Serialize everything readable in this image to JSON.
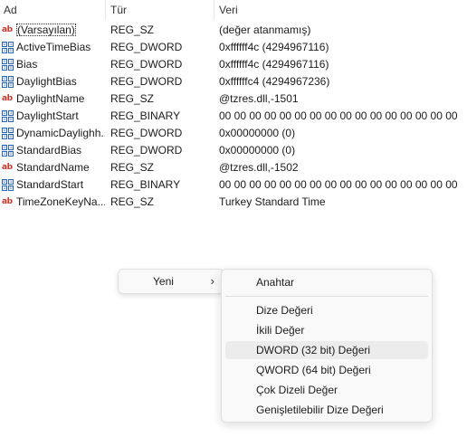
{
  "columns": {
    "name": "Ad",
    "type": "Tür",
    "data": "Veri"
  },
  "rows": [
    {
      "icon": "string-value-icon",
      "name": "(Varsayılan)",
      "type": "REG_SZ",
      "data": "(değer atanmamış)",
      "selected": true
    },
    {
      "icon": "binary-value-icon",
      "name": "ActiveTimeBias",
      "type": "REG_DWORD",
      "data": "0xffffff4c (4294967116)"
    },
    {
      "icon": "binary-value-icon",
      "name": "Bias",
      "type": "REG_DWORD",
      "data": "0xffffff4c (4294967116)"
    },
    {
      "icon": "binary-value-icon",
      "name": "DaylightBias",
      "type": "REG_DWORD",
      "data": "0xffffffc4 (4294967236)"
    },
    {
      "icon": "string-value-icon",
      "name": "DaylightName",
      "type": "REG_SZ",
      "data": "@tzres.dll,-1501"
    },
    {
      "icon": "binary-value-icon",
      "name": "DaylightStart",
      "type": "REG_BINARY",
      "data": "00 00 00 00 00 00 00 00 00 00 00 00 00 00 00 00"
    },
    {
      "icon": "binary-value-icon",
      "name": "DynamicDaylightTimeDisabled",
      "type": "REG_DWORD",
      "data": "0x00000000 (0)"
    },
    {
      "icon": "binary-value-icon",
      "name": "StandardBias",
      "type": "REG_DWORD",
      "data": "0x00000000 (0)"
    },
    {
      "icon": "string-value-icon",
      "name": "StandardName",
      "type": "REG_SZ",
      "data": "@tzres.dll,-1502"
    },
    {
      "icon": "binary-value-icon",
      "name": "StandardStart",
      "type": "REG_BINARY",
      "data": "00 00 00 00 00 00 00 00 00 00 00 00 00 00 00 00"
    },
    {
      "icon": "string-value-icon",
      "name": "TimeZoneKeyName",
      "type": "REG_SZ",
      "data": "Turkey Standard Time"
    }
  ],
  "row_names_display": [
    "(Varsayılan)",
    "ActiveTimeBias",
    "Bias",
    "DaylightBias",
    "DaylightName",
    "DaylightStart",
    "DynamicDaylighh...",
    "StandardBias",
    "StandardName",
    "StandardStart",
    "TimeZoneKeyNa..."
  ],
  "context_menu": {
    "new_label": "Yeni",
    "chevron": "›"
  },
  "submenu": {
    "key_label": "Anahtar",
    "items": [
      "Dize Değeri",
      "İkili Değer",
      "DWORD (32 bit) Değeri",
      "QWORD (64 bit) Değeri",
      "Çok Dizeli Değer",
      "Genişletilebilir Dize Değeri"
    ],
    "hovered_index": 2
  },
  "icons": {
    "string_glyph": "ab",
    "binary_glyph": [
      "0",
      "1",
      "1",
      "0"
    ]
  },
  "colors": {
    "string_icon": "#c0392b",
    "binary_icon": "#2a64b4",
    "menu_bg": "#f9f9f9",
    "menu_hover": "#ececec"
  }
}
